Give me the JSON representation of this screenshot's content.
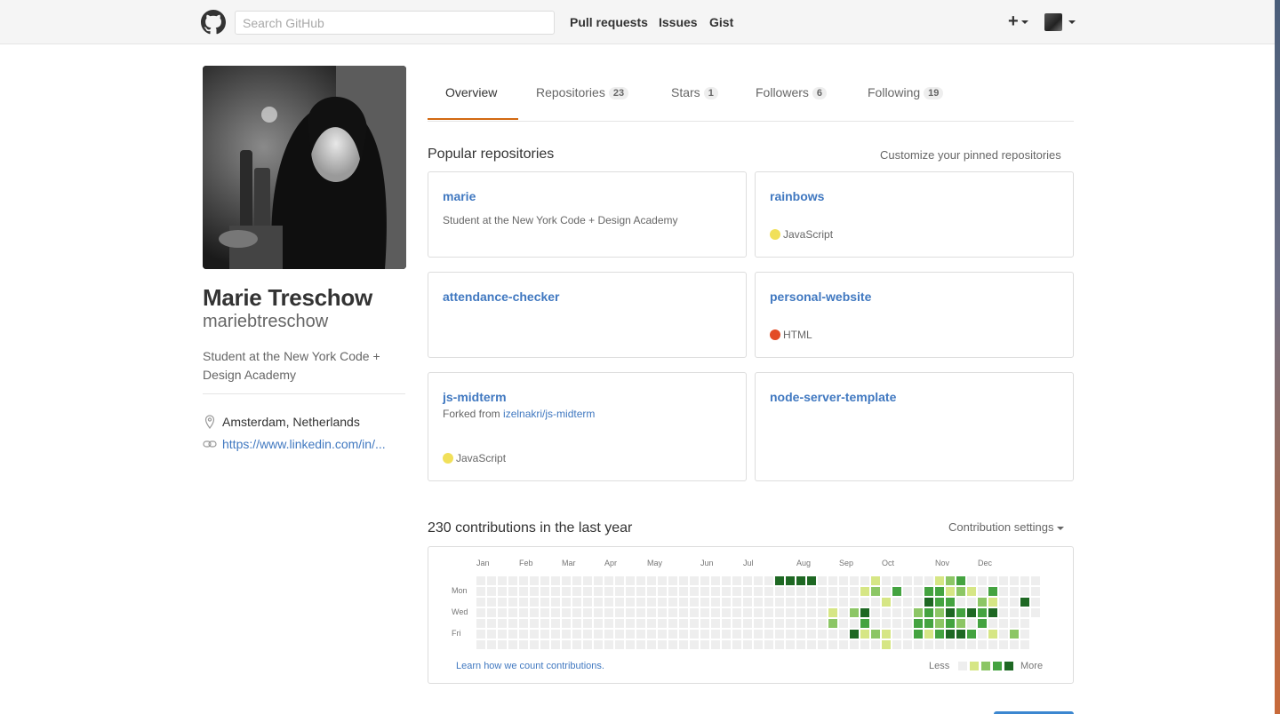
{
  "header": {
    "search_placeholder": "Search GitHub",
    "nav": [
      "Pull requests",
      "Issues",
      "Gist"
    ],
    "plus_label": "+"
  },
  "profile": {
    "full_name": "Marie Treschow",
    "username": "mariebtreschow",
    "bio": "Student at the New York Code + Design Academy",
    "location": "Amsterdam, Netherlands",
    "website": "https://www.linkedin.com/in/..."
  },
  "tabs": [
    {
      "label": "Overview",
      "count": null
    },
    {
      "label": "Repositories",
      "count": "23"
    },
    {
      "label": "Stars",
      "count": "1"
    },
    {
      "label": "Followers",
      "count": "6"
    },
    {
      "label": "Following",
      "count": "19"
    }
  ],
  "popular": {
    "title": "Popular repositories",
    "customize_label": "Customize your pinned repositories",
    "repos": [
      {
        "name": "marie",
        "description": "Student at the New York Code + Design Academy",
        "forked_prefix": "",
        "forked_from": "",
        "language": "",
        "language_color": ""
      },
      {
        "name": "rainbows",
        "description": "",
        "forked_prefix": "",
        "forked_from": "",
        "language": "JavaScript",
        "language_color": "#f1e05a"
      },
      {
        "name": "attendance-checker",
        "description": "",
        "forked_prefix": "",
        "forked_from": "",
        "language": "",
        "language_color": ""
      },
      {
        "name": "personal-website",
        "description": "",
        "forked_prefix": "",
        "forked_from": "",
        "language": "HTML",
        "language_color": "#e34c26"
      },
      {
        "name": "js-midterm",
        "description": "",
        "forked_prefix": "Forked from",
        "forked_from": "izelnakri/js-midterm",
        "language": "JavaScript",
        "language_color": "#f1e05a"
      },
      {
        "name": "node-server-template",
        "description": "",
        "forked_prefix": "",
        "forked_from": "",
        "language": "",
        "language_color": ""
      }
    ]
  },
  "contributions": {
    "title": "230 contributions in the last year",
    "settings_label": "Contribution settings",
    "months": [
      "Jan",
      "Feb",
      "Mar",
      "Apr",
      "May",
      "Jun",
      "Jul",
      "Aug",
      "Sep",
      "Oct",
      "Nov",
      "Dec"
    ],
    "weekdays": [
      "Mon",
      "Wed",
      "Fri"
    ],
    "learn_label": "Learn how we count contributions.",
    "legend_less": "Less",
    "legend_more": "More",
    "colors": [
      "#eeeeee",
      "#d6e685",
      "#8cc665",
      "#44a340",
      "#1e6823"
    ],
    "active_weeks": [
      [
        4,
        0,
        0,
        0,
        0,
        0,
        0
      ],
      [
        4,
        0,
        0,
        0,
        0,
        0,
        0
      ],
      [
        4,
        0,
        0,
        0,
        0,
        0,
        0
      ],
      [
        4,
        0,
        0,
        0,
        0,
        0,
        0
      ],
      [
        0,
        0,
        0,
        0,
        0,
        0,
        0
      ],
      [
        0,
        0,
        0,
        1,
        2,
        0,
        0
      ],
      [
        0,
        0,
        0,
        0,
        0,
        0,
        0
      ],
      [
        0,
        0,
        0,
        2,
        0,
        4,
        0
      ],
      [
        0,
        1,
        0,
        4,
        3,
        1,
        0
      ],
      [
        1,
        2,
        0,
        0,
        0,
        2,
        0
      ],
      [
        0,
        0,
        1,
        0,
        0,
        1,
        1
      ],
      [
        0,
        3,
        0,
        0,
        0,
        0,
        0
      ],
      [
        0,
        0,
        0,
        0,
        0,
        0,
        0
      ],
      [
        0,
        0,
        0,
        2,
        3,
        3,
        0
      ],
      [
        0,
        3,
        4,
        3,
        3,
        1,
        0
      ],
      [
        1,
        3,
        3,
        2,
        2,
        3,
        0
      ],
      [
        2,
        1,
        3,
        4,
        3,
        4,
        0
      ],
      [
        3,
        2,
        0,
        3,
        2,
        4,
        0
      ],
      [
        0,
        1,
        0,
        4,
        0,
        3,
        0
      ],
      [
        0,
        0,
        2,
        3,
        3,
        0,
        0
      ],
      [
        0,
        3,
        1,
        4,
        0,
        1,
        0
      ],
      [
        0,
        0,
        0,
        0,
        0,
        0,
        0
      ],
      [
        0,
        0,
        0,
        0,
        0,
        2,
        0
      ],
      [
        0,
        0,
        4,
        0,
        0,
        0,
        0
      ]
    ]
  }
}
